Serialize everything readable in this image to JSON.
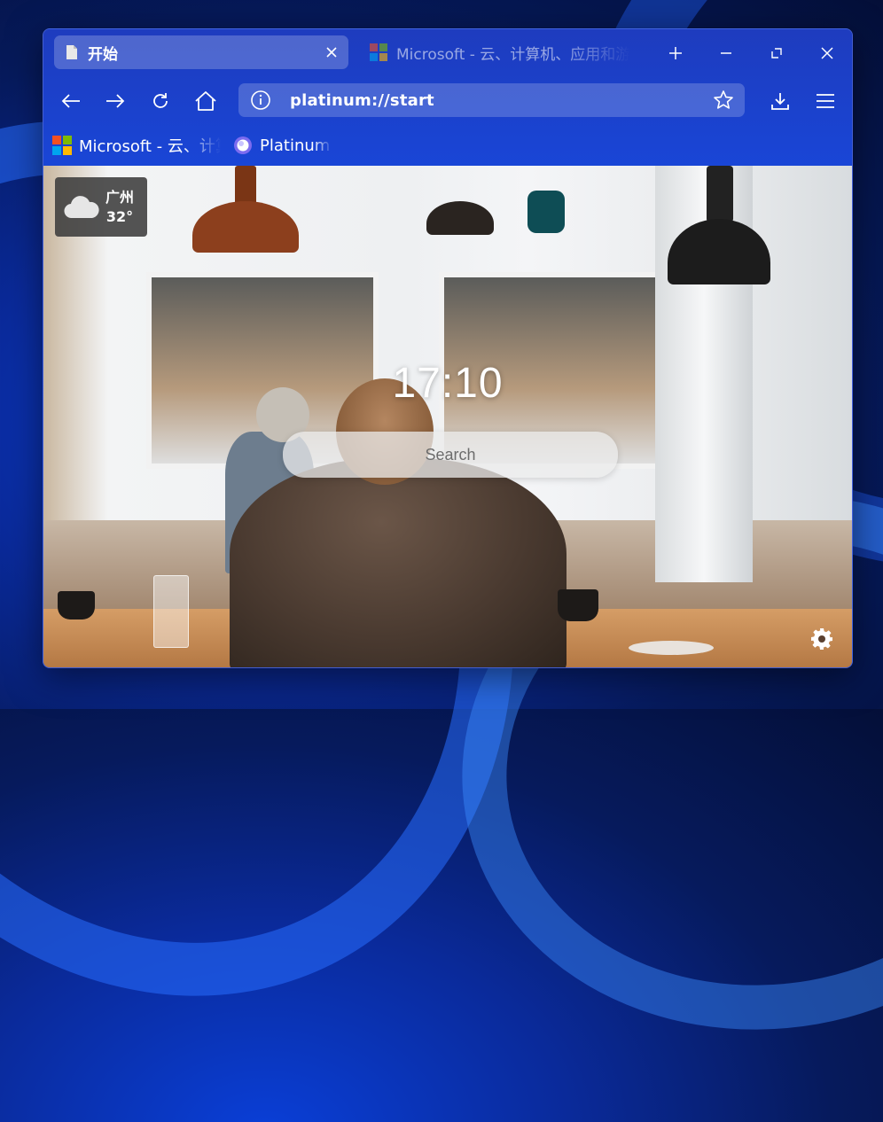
{
  "tabs": [
    {
      "title": "开始",
      "icon": "page-icon",
      "active": true
    },
    {
      "title": "Microsoft - 云、计算机、应用和游戏",
      "icon": "microsoft-logo-icon",
      "active": false
    }
  ],
  "window_controls": [
    "new-tab-icon",
    "minimize-icon",
    "restore-icon",
    "close-icon"
  ],
  "toolbar": {
    "back": "back-arrow-icon",
    "forward": "forward-arrow-icon",
    "reload": "reload-icon",
    "home": "home-icon",
    "downloads": "download-icon",
    "menu": "menu-icon"
  },
  "address_bar": {
    "url": "platinum://start",
    "info_icon": "info-icon",
    "bookmark_icon": "star-icon"
  },
  "bookmarks": [
    {
      "label": "Microsoft - 云、计算机、应用和游戏",
      "icon": "microsoft-logo-icon"
    },
    {
      "label": "Platinum",
      "icon": "platinum-logo-icon"
    }
  ],
  "start_page": {
    "weather": {
      "city": "广州",
      "temperature": "32°",
      "icon": "cloud-icon"
    },
    "clock": "17:10",
    "search_placeholder": "Search",
    "settings_icon": "gear-icon"
  },
  "colors": {
    "chrome": "#1a3fd6",
    "desktop": "#0a2a9a",
    "weather_bg": "#3c3c3c"
  }
}
